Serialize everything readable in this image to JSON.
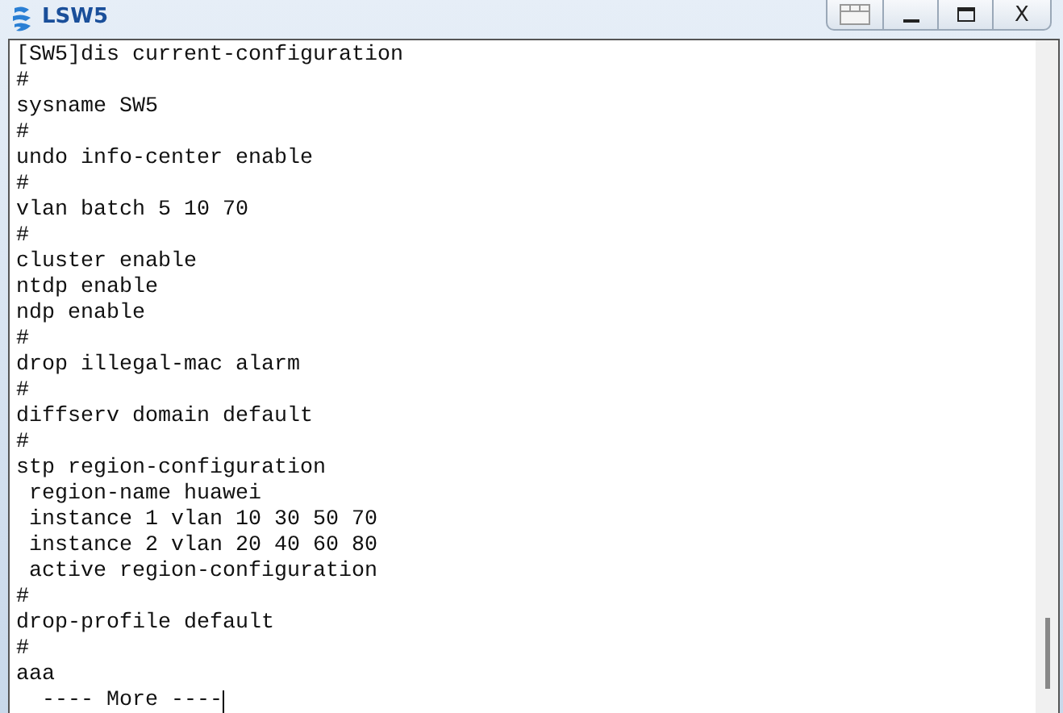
{
  "window": {
    "title": "LSW5",
    "close_label": "X"
  },
  "terminal": {
    "lines": [
      "[SW5]dis current-configuration",
      "#",
      "sysname SW5",
      "#",
      "undo info-center enable",
      "#",
      "vlan batch 5 10 70",
      "#",
      "cluster enable",
      "ntdp enable",
      "ndp enable",
      "#",
      "drop illegal-mac alarm",
      "#",
      "diffserv domain default",
      "#",
      "stp region-configuration",
      " region-name huawei",
      " instance 1 vlan 10 30 50 70",
      " instance 2 vlan 20 40 60 80",
      " active region-configuration",
      "#",
      "drop-profile default",
      "#",
      "aaa",
      "  ---- More ----"
    ]
  }
}
